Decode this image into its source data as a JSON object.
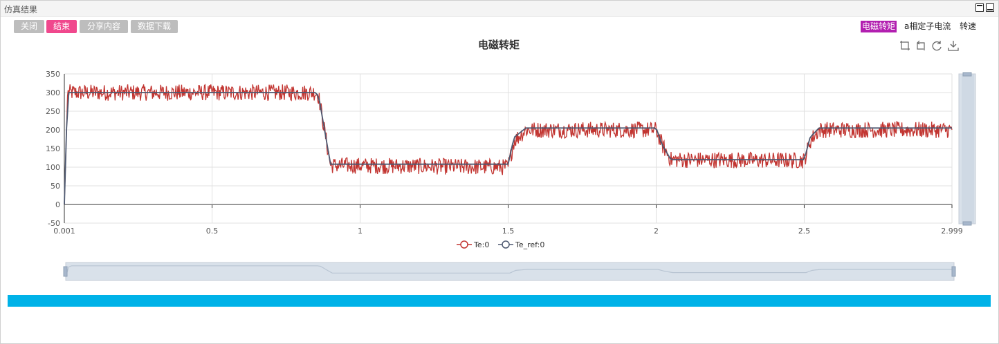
{
  "window": {
    "title": "仿真结果"
  },
  "toolbar": {
    "buttons": [
      {
        "label": "关闭",
        "active": false
      },
      {
        "label": "结束",
        "active": true
      },
      {
        "label": "分享内容",
        "active": false
      },
      {
        "label": "数据下载",
        "active": false
      }
    ]
  },
  "tabs": [
    {
      "label": "电磁转矩",
      "active": true
    },
    {
      "label": "a相定子电流",
      "active": false
    },
    {
      "label": "转速",
      "active": false
    }
  ],
  "toolbox": {
    "icons": [
      "zoom-select-icon",
      "zoom-reset-icon",
      "restore-icon",
      "save-image-icon"
    ]
  },
  "colors": {
    "te": "#c23531",
    "te_ref": "#4d5870",
    "active_button": "#f0488d",
    "active_tab": "#b21fb0",
    "progress": "#00b2e8"
  },
  "chart_data": {
    "type": "line",
    "title": "电磁转矩",
    "xlabel": "",
    "ylabel": "",
    "x_ticks": [
      "0.001",
      "0.5",
      "1",
      "1.5",
      "2",
      "2.5",
      "2.999"
    ],
    "y_ticks": [
      350,
      300,
      250,
      200,
      150,
      100,
      50,
      0,
      -50
    ],
    "xlim": [
      0.001,
      2.999
    ],
    "ylim": [
      -50,
      350
    ],
    "grid": true,
    "legend": "bottom",
    "dataZoom": {
      "slider_x": true,
      "slider_y": true
    },
    "series": [
      {
        "name": "Te:0",
        "noise_band": 22,
        "x": [
          0.001,
          0.012,
          0.85,
          0.86,
          0.9,
          1.5,
          1.52,
          1.56,
          2.0,
          2.02,
          2.05,
          2.5,
          2.52,
          2.55,
          2.999
        ],
        "y": [
          0,
          300,
          300,
          290,
          105,
          100,
          170,
          200,
          200,
          160,
          120,
          118,
          170,
          200,
          200
        ]
      },
      {
        "name": "Te_ref:0",
        "noise_band": 0,
        "x": [
          0.001,
          0.012,
          0.85,
          0.86,
          0.9,
          1.5,
          1.52,
          1.56,
          2.0,
          2.02,
          2.05,
          2.5,
          2.52,
          2.55,
          2.999
        ],
        "y": [
          0,
          300,
          300,
          290,
          108,
          108,
          180,
          205,
          205,
          160,
          120,
          120,
          180,
          205,
          205
        ]
      }
    ]
  }
}
